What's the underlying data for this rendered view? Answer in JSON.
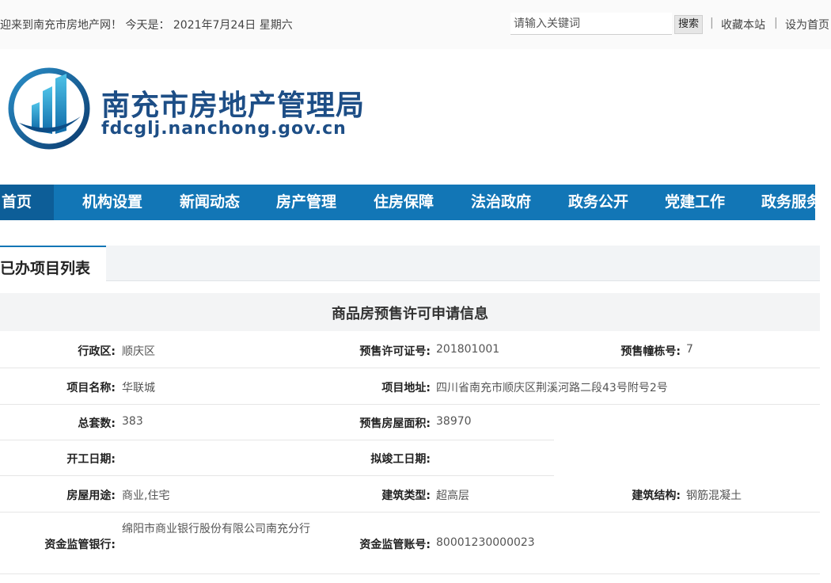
{
  "topbar": {
    "welcome": "迎来到南充市房地产网！ 今天是： 2021年7月24日 星期六",
    "search_placeholder": "请输入关键词",
    "search_button": "搜索",
    "separator": "|",
    "bookmark": "收藏本站",
    "set_home": "设为首页"
  },
  "header": {
    "title": "南充市房地产管理局",
    "domain": "fdcglj.nanchong.gov.cn"
  },
  "nav": {
    "items": [
      "首页",
      "机构设置",
      "新闻动态",
      "房产管理",
      "住房保障",
      "法治政府",
      "政务公开",
      "党建工作",
      "政务服务"
    ]
  },
  "tab": {
    "label": "已办项目列表"
  },
  "panel": {
    "title": "商品房预售许可申请信息",
    "fields": {
      "district_label": "行政区:",
      "district": "顺庆区",
      "permit_no_label": "预售许可证号:",
      "permit_no": "201801001",
      "building_no_label": "预售幢栋号:",
      "building_no": "7",
      "project_name_label": "项目名称:",
      "project_name": "华联城",
      "project_address_label": "项目地址:",
      "project_address": "四川省南充市顺庆区荆溪河路二段43号附号2号",
      "total_units_label": "总套数:",
      "total_units": "383",
      "presale_area_label": "预售房屋面积:",
      "presale_area": "38970",
      "start_date_label": "开工日期:",
      "completion_date_label": "拟竣工日期:",
      "usage_label": "房屋用途:",
      "usage": "商业,住宅",
      "building_type_label": "建筑类型:",
      "building_type": "超高层",
      "structure_label": "建筑结构:",
      "structure": "钢筋混凝土",
      "bank_label": "资金监管银行:",
      "bank": "绵阳市商业银行股份有限公司南充分行",
      "account_label": "资金监管账号:",
      "account": "80001230000023"
    }
  },
  "colors": {
    "nav_bg": "#1276b6",
    "nav_active": "#0d5e98",
    "brand": "#1d4e86"
  }
}
